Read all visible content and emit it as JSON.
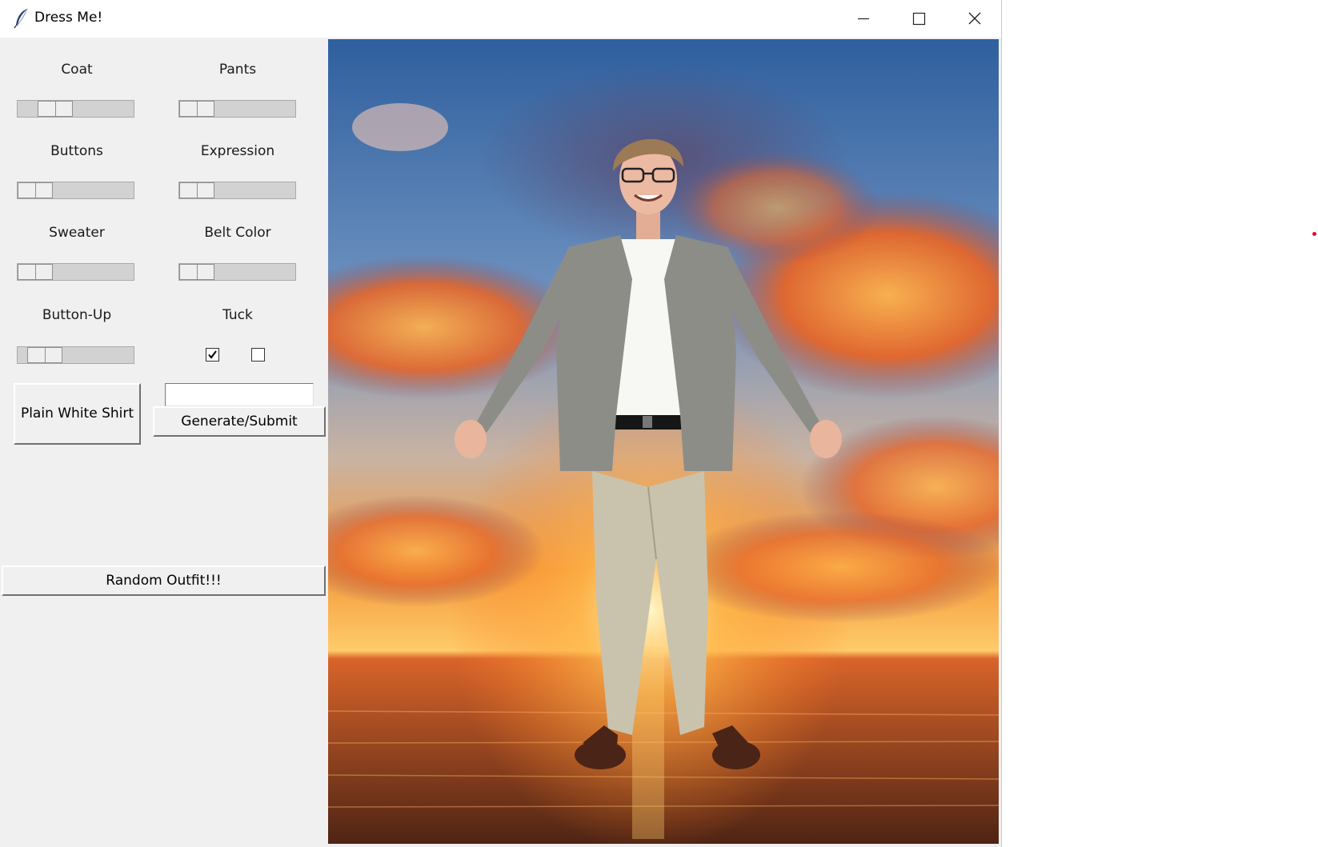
{
  "window": {
    "title": "Dress Me!"
  },
  "titlebar_icons": {
    "app": "feather-icon",
    "minimize": "minimize-icon",
    "maximize": "maximize-icon",
    "close": "close-icon"
  },
  "controls": {
    "coat": {
      "label": "Coat",
      "value": 0.25
    },
    "pants": {
      "label": "Pants",
      "value": 0
    },
    "buttons": {
      "label": "Buttons",
      "value": 0
    },
    "expression": {
      "label": "Expression",
      "value": 0
    },
    "sweater": {
      "label": "Sweater",
      "value": 0
    },
    "belt_color": {
      "label": "Belt Color",
      "value": 0
    },
    "button_up": {
      "label": "Button-Up",
      "value": 0.12
    },
    "tuck": {
      "label": "Tuck",
      "checkbox_1_checked": true,
      "checkbox_2_checked": false
    }
  },
  "buttons": {
    "plain_white_shirt": "Plain White Shirt",
    "generate_submit": "Generate/Submit",
    "random_outfit": "Random Outfit!!!"
  },
  "entry": {
    "value": ""
  },
  "colors": {
    "sky_top": "#2f5f9e",
    "sky_mid": "#6a8fbe",
    "sunset_orange": "#f07a25",
    "sun": "#ffe48a",
    "sea": "#5a2a16",
    "jacket": "#8d8d88",
    "shirt": "#f7f7f4",
    "pants": "#c9c3ad",
    "shoes": "#4a2416"
  }
}
